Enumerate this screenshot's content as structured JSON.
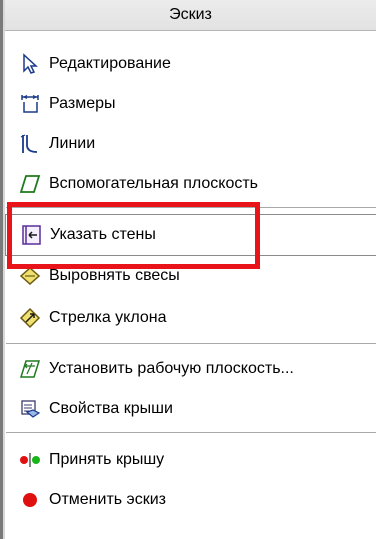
{
  "panel": {
    "title": "Эскиз"
  },
  "items": [
    {
      "label": "Редактирование",
      "icon": "cursor-arrow-icon"
    },
    {
      "label": "Размеры",
      "icon": "dimensions-icon"
    },
    {
      "label": "Линии",
      "icon": "lines-icon"
    },
    {
      "label": "Вспомогательная плоскость",
      "icon": "work-plane-icon"
    },
    {
      "label": "Указать стены",
      "icon": "pick-walls-icon"
    },
    {
      "label": "Выровнять свесы",
      "icon": "align-eaves-icon"
    },
    {
      "label": "Стрелка уклона",
      "icon": "slope-arrow-icon"
    },
    {
      "label": "Установить рабочую плоскость...",
      "icon": "set-work-plane-icon"
    },
    {
      "label": "Свойства крыши",
      "icon": "roof-properties-icon"
    },
    {
      "label": "Принять крышу",
      "icon": "finish-roof-icon"
    },
    {
      "label": "Отменить эскиз",
      "icon": "cancel-sketch-icon"
    }
  ],
  "highlight_color": "#e8141a"
}
